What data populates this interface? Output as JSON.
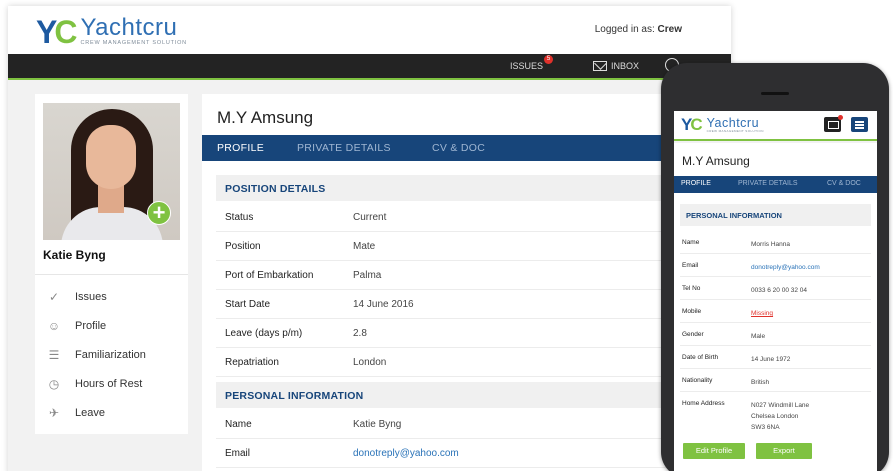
{
  "brand": {
    "mark_y": "Y",
    "mark_c": "C",
    "name": "Yachtcru",
    "tagline": "CREW MANAGEMENT SOLUTION",
    "accent": "#7fc241",
    "primary": "#17457a"
  },
  "header": {
    "login_prefix": "Logged in as:",
    "login_user": "Crew"
  },
  "nav": {
    "issues_label": "ISSUES",
    "issues_count": "5",
    "inbox_label": "INBOX",
    "power_icon": "power-icon"
  },
  "profile": {
    "name": "Katie Byng",
    "menu": [
      {
        "label": "Issues",
        "icon": "✓"
      },
      {
        "label": "Profile",
        "icon": "☺"
      },
      {
        "label": "Familiarization",
        "icon": "☰"
      },
      {
        "label": "Hours of Rest",
        "icon": "◷"
      },
      {
        "label": "Leave",
        "icon": "✈"
      }
    ]
  },
  "main": {
    "vessel": "M.Y Amsung",
    "tabs": [
      "PROFILE",
      "PRIVATE DETAILS",
      "CV & DOC"
    ],
    "position_header": "POSITION DETAILS",
    "position_rows": [
      {
        "k": "Status",
        "v": "Current"
      },
      {
        "k": "Position",
        "v": "Mate"
      },
      {
        "k": "Port of Embarkation",
        "v": "Palma"
      },
      {
        "k": "Start Date",
        "v": "14 June 2016"
      },
      {
        "k": "Leave (days p/m)",
        "v": "2.8"
      },
      {
        "k": "Repatriation",
        "v": "London"
      }
    ],
    "personal_header": "PERSONAL INFORMATION",
    "personal_rows": [
      {
        "k": "Name",
        "v": "Katie Byng"
      },
      {
        "k": "Email",
        "v": "donotreply@yahoo.com"
      }
    ]
  },
  "mobile": {
    "vessel": "M.Y Amsung",
    "tabs": [
      "PROFILE",
      "PRIVATE DETAILS",
      "CV & DOC"
    ],
    "section_header": "PERSONAL INFORMATION",
    "rows": [
      {
        "k": "Name",
        "v": "Morris Hanna"
      },
      {
        "k": "Email",
        "v": "donotreply@yahoo.com"
      },
      {
        "k": "Tel No",
        "v": "0033 6 20 00 32 04"
      },
      {
        "k": "Mobile",
        "v": "Missing"
      },
      {
        "k": "Gender",
        "v": "Male"
      },
      {
        "k": "Date of Birth",
        "v": "14 June 1972"
      },
      {
        "k": "Nationality",
        "v": "British"
      },
      {
        "k": "Home Address",
        "v1": "N027 Windmill Lane",
        "v2": "Chelsea London",
        "v3": "SW3 6NA"
      }
    ],
    "edit_button": "Edit Profile",
    "export_button": "Export"
  }
}
